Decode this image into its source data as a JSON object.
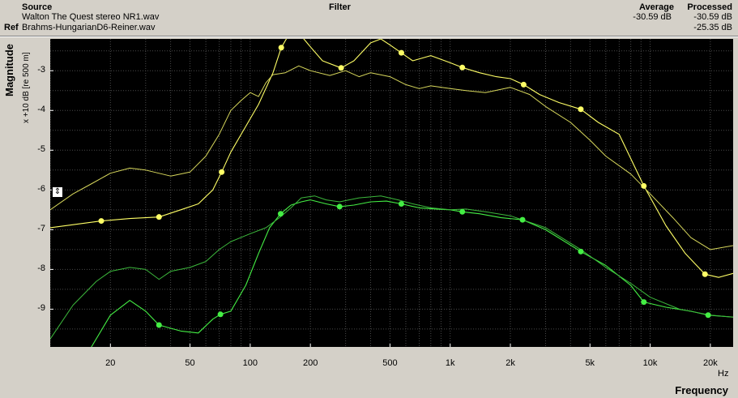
{
  "header": {
    "source_label": "Source",
    "ref_label": "Ref",
    "filter_label": "Filter",
    "average_label": "Average",
    "processed_label": "Processed",
    "source_file": "Walton The Quest stereo NR1.wav",
    "ref_file": "Brahms-HungarianD6-Reiner.wav",
    "source_average": "-30.59 dB",
    "source_processed": "-30.59 dB",
    "ref_processed": "-25.35 dB"
  },
  "chart_data": {
    "type": "line",
    "xlabel": "Frequency",
    "xunit": "Hz",
    "ylabel": "Magnitude",
    "ylabel_sub": "x +10 dB [re 500 m]",
    "xscale": "log",
    "xlim": [
      10,
      26000
    ],
    "ylim": [
      -9.95,
      -2.2
    ],
    "grid": true,
    "x_ticks": [
      20,
      50,
      100,
      200,
      500,
      1000,
      2000,
      5000,
      10000,
      20000
    ],
    "x_tick_labels": [
      "20",
      "50",
      "100",
      "200",
      "500",
      "1k",
      "2k",
      "5k",
      "10k",
      "20k"
    ],
    "y_ticks": [
      -3,
      -4,
      -5,
      -6,
      -7,
      -8,
      -9
    ],
    "y_tick_labels": [
      "-3",
      "-4",
      "-5",
      "-6",
      "-7",
      "-8",
      "-9"
    ],
    "series": [
      {
        "color": "#ffff66",
        "width": 1.1,
        "markers": true,
        "points": [
          [
            10,
            -6.95
          ],
          [
            18,
            -6.78
          ],
          [
            25,
            -6.72
          ],
          [
            35,
            -6.68
          ],
          [
            45,
            -6.5
          ],
          [
            55,
            -6.35
          ],
          [
            65,
            -6.0
          ],
          [
            72,
            -5.55
          ],
          [
            80,
            -5.05
          ],
          [
            95,
            -4.4
          ],
          [
            110,
            -3.85
          ],
          [
            130,
            -3.05
          ],
          [
            143,
            -2.42
          ],
          [
            160,
            -2.0
          ],
          [
            175,
            -2.05
          ],
          [
            200,
            -2.4
          ],
          [
            230,
            -2.75
          ],
          [
            285,
            -2.93
          ],
          [
            330,
            -2.75
          ],
          [
            400,
            -2.3
          ],
          [
            450,
            -2.2
          ],
          [
            500,
            -2.35
          ],
          [
            570,
            -2.55
          ],
          [
            650,
            -2.75
          ],
          [
            800,
            -2.62
          ],
          [
            1000,
            -2.8
          ],
          [
            1150,
            -2.92
          ],
          [
            1400,
            -3.05
          ],
          [
            1700,
            -3.15
          ],
          [
            2000,
            -3.2
          ],
          [
            2330,
            -3.35
          ],
          [
            2800,
            -3.6
          ],
          [
            3500,
            -3.8
          ],
          [
            4500,
            -3.97
          ],
          [
            5500,
            -4.3
          ],
          [
            7000,
            -4.6
          ],
          [
            9300,
            -5.9
          ],
          [
            12000,
            -6.9
          ],
          [
            15000,
            -7.6
          ],
          [
            18800,
            -8.12
          ],
          [
            22000,
            -8.2
          ],
          [
            26000,
            -8.1
          ]
        ],
        "marker_x": [
          18,
          35,
          72,
          143,
          285,
          570,
          1150,
          2330,
          4500,
          9300,
          18800
        ]
      },
      {
        "color": "#d8d85c",
        "width": 1.0,
        "points": [
          [
            10,
            -6.5
          ],
          [
            13,
            -6.1
          ],
          [
            16,
            -5.85
          ],
          [
            20,
            -5.58
          ],
          [
            25,
            -5.45
          ],
          [
            30,
            -5.5
          ],
          [
            40,
            -5.65
          ],
          [
            50,
            -5.55
          ],
          [
            60,
            -5.15
          ],
          [
            70,
            -4.6
          ],
          [
            80,
            -4.0
          ],
          [
            90,
            -3.75
          ],
          [
            100,
            -3.55
          ],
          [
            110,
            -3.65
          ],
          [
            120,
            -3.3
          ],
          [
            130,
            -3.1
          ],
          [
            150,
            -3.05
          ],
          [
            175,
            -2.88
          ],
          [
            200,
            -3.0
          ],
          [
            250,
            -3.12
          ],
          [
            300,
            -3.0
          ],
          [
            350,
            -3.15
          ],
          [
            400,
            -3.05
          ],
          [
            500,
            -3.15
          ],
          [
            600,
            -3.35
          ],
          [
            700,
            -3.45
          ],
          [
            800,
            -3.38
          ],
          [
            1000,
            -3.45
          ],
          [
            1200,
            -3.5
          ],
          [
            1500,
            -3.55
          ],
          [
            2000,
            -3.42
          ],
          [
            2500,
            -3.6
          ],
          [
            3000,
            -3.9
          ],
          [
            4000,
            -4.3
          ],
          [
            5000,
            -4.75
          ],
          [
            6000,
            -5.15
          ],
          [
            8000,
            -5.6
          ],
          [
            10000,
            -6.1
          ],
          [
            13000,
            -6.7
          ],
          [
            16000,
            -7.2
          ],
          [
            20000,
            -7.5
          ],
          [
            26000,
            -7.4
          ]
        ]
      },
      {
        "color": "#44ee44",
        "width": 1.1,
        "markers": true,
        "points": [
          [
            10,
            -11.5
          ],
          [
            15,
            -10.2
          ],
          [
            20,
            -9.15
          ],
          [
            25,
            -8.78
          ],
          [
            30,
            -9.05
          ],
          [
            35,
            -9.4
          ],
          [
            45,
            -9.55
          ],
          [
            55,
            -9.6
          ],
          [
            65,
            -9.25
          ],
          [
            71,
            -9.13
          ],
          [
            80,
            -9.05
          ],
          [
            95,
            -8.4
          ],
          [
            110,
            -7.6
          ],
          [
            125,
            -6.95
          ],
          [
            142,
            -6.6
          ],
          [
            160,
            -6.38
          ],
          [
            180,
            -6.3
          ],
          [
            200,
            -6.25
          ],
          [
            240,
            -6.35
          ],
          [
            280,
            -6.42
          ],
          [
            330,
            -6.38
          ],
          [
            400,
            -6.3
          ],
          [
            480,
            -6.28
          ],
          [
            570,
            -6.35
          ],
          [
            700,
            -6.45
          ],
          [
            850,
            -6.48
          ],
          [
            1000,
            -6.5
          ],
          [
            1150,
            -6.55
          ],
          [
            1400,
            -6.6
          ],
          [
            1800,
            -6.7
          ],
          [
            2300,
            -6.75
          ],
          [
            3000,
            -7.0
          ],
          [
            4500,
            -7.55
          ],
          [
            6000,
            -7.9
          ],
          [
            8000,
            -8.4
          ],
          [
            9300,
            -8.82
          ],
          [
            12000,
            -8.95
          ],
          [
            16000,
            -9.05
          ],
          [
            19500,
            -9.15
          ],
          [
            23000,
            -9.18
          ],
          [
            26000,
            -9.2
          ]
        ],
        "marker_x": [
          35,
          71,
          142,
          280,
          570,
          1150,
          2300,
          4500,
          9300,
          19500
        ]
      },
      {
        "color": "#3cb83c",
        "width": 1.0,
        "points": [
          [
            10,
            -9.75
          ],
          [
            13,
            -8.9
          ],
          [
            17,
            -8.3
          ],
          [
            20,
            -8.05
          ],
          [
            25,
            -7.95
          ],
          [
            30,
            -8.0
          ],
          [
            35,
            -8.25
          ],
          [
            40,
            -8.05
          ],
          [
            50,
            -7.95
          ],
          [
            60,
            -7.8
          ],
          [
            70,
            -7.5
          ],
          [
            80,
            -7.3
          ],
          [
            100,
            -7.1
          ],
          [
            120,
            -6.95
          ],
          [
            140,
            -6.7
          ],
          [
            160,
            -6.45
          ],
          [
            180,
            -6.2
          ],
          [
            210,
            -6.15
          ],
          [
            240,
            -6.25
          ],
          [
            280,
            -6.3
          ],
          [
            350,
            -6.2
          ],
          [
            450,
            -6.15
          ],
          [
            550,
            -6.25
          ],
          [
            650,
            -6.35
          ],
          [
            800,
            -6.45
          ],
          [
            1000,
            -6.5
          ],
          [
            1200,
            -6.48
          ],
          [
            1500,
            -6.55
          ],
          [
            2000,
            -6.65
          ],
          [
            3000,
            -6.95
          ],
          [
            4500,
            -7.5
          ],
          [
            6000,
            -7.95
          ],
          [
            8000,
            -8.35
          ],
          [
            10000,
            -8.7
          ],
          [
            14000,
            -9.0
          ],
          [
            20000,
            -9.15
          ],
          [
            26000,
            -9.2
          ]
        ]
      }
    ]
  }
}
